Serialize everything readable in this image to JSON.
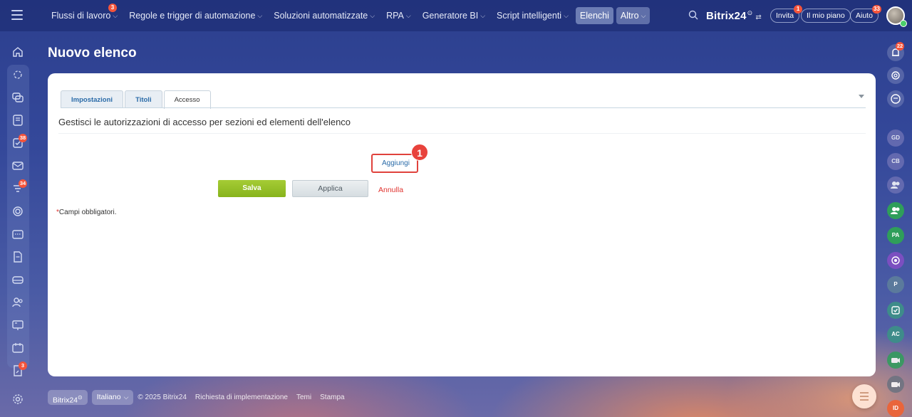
{
  "topbar": {
    "nav": [
      {
        "label": "Flussi di lavoro",
        "chevron": true,
        "badge": "3"
      },
      {
        "label": "Regole e trigger di automazione",
        "chevron": true
      },
      {
        "label": "Soluzioni automatizzate",
        "chevron": true
      },
      {
        "label": "RPA",
        "chevron": true
      },
      {
        "label": "Generatore BI",
        "chevron": true
      },
      {
        "label": "Script intelligenti",
        "chevron": true
      },
      {
        "label": "Elenchi",
        "active": true
      },
      {
        "label": "Altro",
        "chevron": true
      }
    ],
    "brand": "Bitrix",
    "brand_num": "24",
    "invite_label": "Invita",
    "invite_badge": "1",
    "plan_label": "Il mio piano",
    "help_label": "Aiuto",
    "help_badge": "33"
  },
  "left_sidebar": {
    "badges": {
      "tasks": "38",
      "feed": "34",
      "bottom": "3"
    }
  },
  "right_sidebar": {
    "notif_badge": "22",
    "avatars": [
      {
        "initials": "GD",
        "color": "#6b6fb3"
      },
      {
        "initials": "CB",
        "color": "#6b6fb3"
      },
      {
        "initials": "",
        "color": "#6b6fb3"
      },
      {
        "initials": "",
        "color": "#2f9e5a"
      },
      {
        "initials": "PA",
        "color": "#2f9e5a"
      },
      {
        "initials": "",
        "color": "#7b4fc0"
      },
      {
        "initials": "P",
        "color": "#5b7a9c"
      },
      {
        "initials": "",
        "color": "#3e8c8a"
      },
      {
        "initials": "AC",
        "color": "#3e8c8a"
      },
      {
        "initials": "",
        "color": "#2f9e5a"
      },
      {
        "initials": "",
        "color": "#6b7280"
      },
      {
        "initials": "ID",
        "color": "#e9653b"
      }
    ]
  },
  "page": {
    "title": "Nuovo elenco"
  },
  "tabs": [
    {
      "label": "Impostazioni",
      "active": false
    },
    {
      "label": "Titoli",
      "active": false
    },
    {
      "label": "Accesso",
      "active": true
    }
  ],
  "form": {
    "section_description": "Gestisci le autorizzazioni di accesso per sezioni ed elementi dell'elenco",
    "add_link": "Aggiungi",
    "step_number": "1",
    "save_label": "Salva",
    "apply_label": "Applica",
    "cancel_label": "Annulla",
    "required_star": "*",
    "required_note": "Campi obbligatori."
  },
  "footer": {
    "brand": "Bitrix24",
    "language": "Italiano",
    "copyright": "© 2025 Bitrix24",
    "links": [
      "Richiesta di implementazione",
      "Temi",
      "Stampa"
    ]
  },
  "colors": {
    "accent_red": "#e0423c",
    "save_green": "#87b41c",
    "link_blue": "#2a6ba8"
  }
}
